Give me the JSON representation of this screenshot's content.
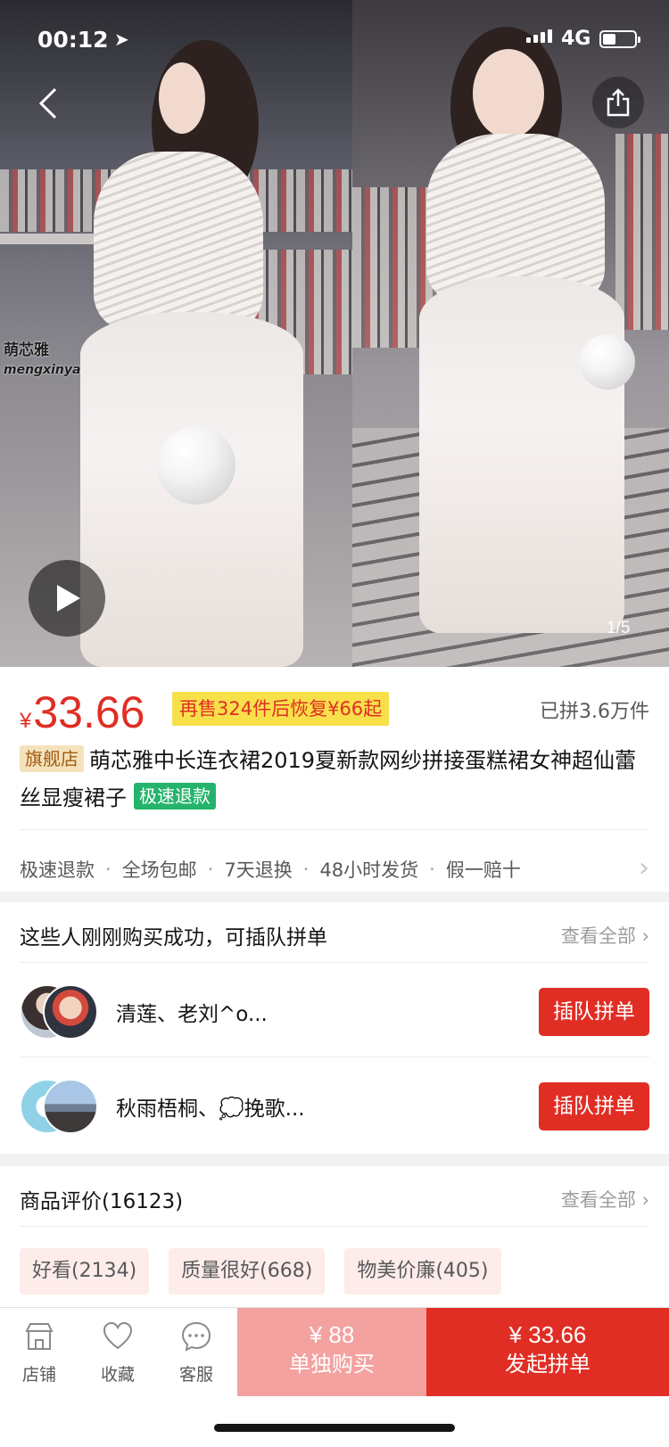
{
  "status_bar": {
    "time": "00:12",
    "network": "4G"
  },
  "hero": {
    "watermark": "萌芯雅",
    "watermark_sub": "mengxinya",
    "page_indicator": "1/5"
  },
  "product": {
    "currency": "¥",
    "price": "33.66",
    "restore_tag": "再售324件后恢复¥66起",
    "sold_count": "已拼3.6万件",
    "flag_tag": "旗舰店",
    "title": "萌芯雅中长连衣裙2019夏新款网纱拼接蛋糕裙女神超仙蕾丝显瘦裙子",
    "refund_tag": "极速退款",
    "services": [
      "极速退款",
      "全场包邮",
      "7天退换",
      "48小时发货",
      "假一赔十"
    ]
  },
  "group_buy": {
    "title": "这些人刚刚购买成功，可插队拼单",
    "see_all": "查看全部",
    "rows": [
      {
        "names": "清莲、老刘^o...",
        "button": "插队拼单"
      },
      {
        "names": "秋雨梧桐、💭挽歌...",
        "button": "插队拼单"
      }
    ]
  },
  "reviews": {
    "title": "商品评价(16123)",
    "see_all": "查看全部",
    "tags": [
      "好看(2134)",
      "质量很好(668)",
      "物美价廉(405)"
    ]
  },
  "bottom_bar": {
    "shop": "店铺",
    "favorite": "收藏",
    "service": "客服",
    "alone_price": "¥ 88",
    "alone_label": "单独购买",
    "group_price": "¥ 33.66",
    "group_label": "发起拼单"
  },
  "colors": {
    "accent": "#e02e24",
    "alone_button": "#f3a2a0",
    "restore_tag_bg": "#f8e04a",
    "refund_tag_bg": "#25b36b",
    "flag_tag_bg": "#f4e2bd"
  },
  "icons": [
    "back-icon",
    "share-icon",
    "play-icon",
    "chevron-right-icon",
    "shop-icon",
    "heart-icon",
    "chat-icon"
  ]
}
